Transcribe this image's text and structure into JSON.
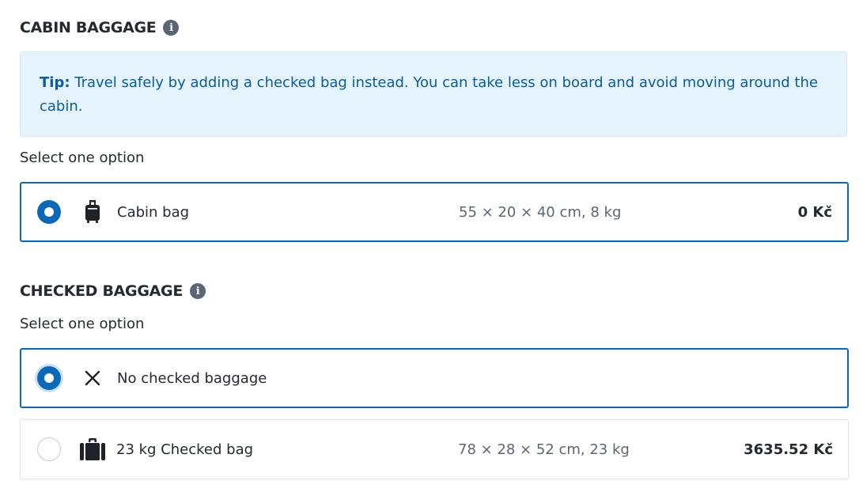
{
  "cabin": {
    "title": "CABIN BAGGAGE",
    "info_icon": "i",
    "tip_label": "Tip:",
    "tip_text": " Travel safely by adding a checked bag instead. You can take less on board and avoid moving around the cabin.",
    "select_label": "Select one option",
    "options": [
      {
        "icon": "cabin-bag-icon",
        "label": "Cabin bag",
        "dimensions": "55 × 20 × 40 cm, 8 kg",
        "price": "0 Kč",
        "selected": true
      }
    ]
  },
  "checked": {
    "title": "CHECKED BAGGAGE",
    "info_icon": "i",
    "select_label": "Select one option",
    "options": [
      {
        "icon": "close-icon",
        "label": "No checked baggage",
        "selected": true
      },
      {
        "icon": "checked-bag-icon",
        "label": "23 kg Checked bag",
        "dimensions": "78 × 28 × 52 cm, 23 kg",
        "price": "3635.52 Kč",
        "selected": false
      }
    ]
  },
  "colors": {
    "accent": "#0a68b8",
    "tip_background": "#e5f3fd",
    "tip_text": "#0a5c9e"
  }
}
